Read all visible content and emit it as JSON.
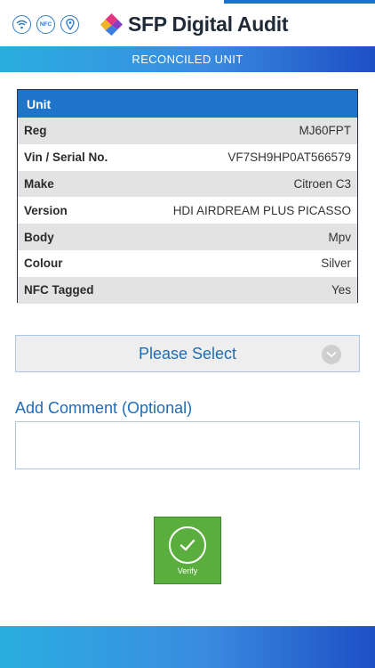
{
  "header": {
    "title": "SFP Digital Audit",
    "icons": [
      "wifi-icon",
      "nfc-icon",
      "location-pin-icon"
    ],
    "nfc_text": "NFC"
  },
  "subbar": {
    "title": "RECONCILED UNIT"
  },
  "unit": {
    "heading": "Unit",
    "rows": [
      {
        "label": "Reg",
        "value": "MJ60FPT"
      },
      {
        "label": "Vin / Serial No.",
        "value": "VF7SH9HP0AT566579"
      },
      {
        "label": "Make",
        "value": "Citroen C3"
      },
      {
        "label": "Version",
        "value": "HDI AIRDREAM PLUS PICASSO"
      },
      {
        "label": "Body",
        "value": "Mpv"
      },
      {
        "label": "Colour",
        "value": "Silver"
      },
      {
        "label": "NFC Tagged",
        "value": "Yes"
      }
    ]
  },
  "select": {
    "label": "Please Select"
  },
  "comment": {
    "label": "Add Comment (Optional)",
    "value": ""
  },
  "verify": {
    "label": "Verify"
  },
  "colors": {
    "accent": "#1f74c9",
    "link": "#1f6cb8",
    "verify_green": "#5aae3d",
    "gradient_start": "#2aaee0",
    "gradient_end": "#1d4fc4"
  }
}
